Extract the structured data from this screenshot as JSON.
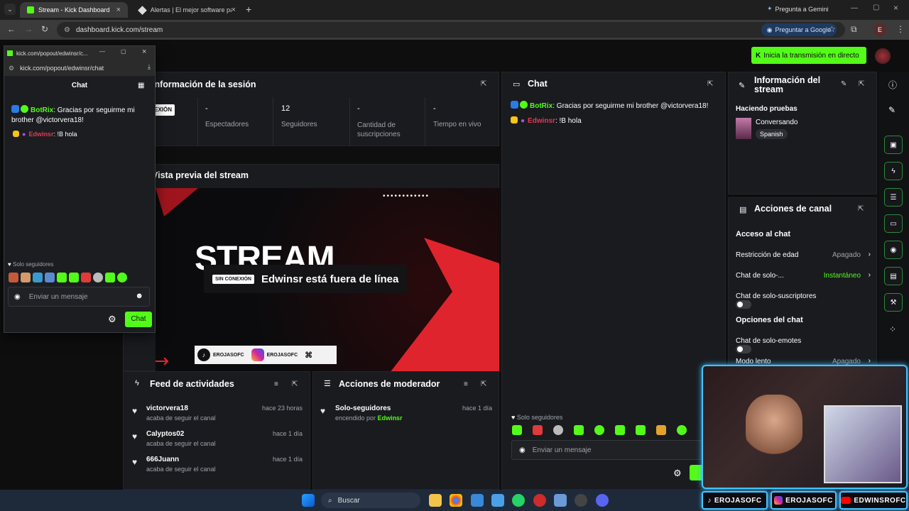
{
  "browser": {
    "tabs": [
      {
        "title": "Stream - Kick Dashboard"
      },
      {
        "title": "Alertas | El mejor software para"
      }
    ],
    "gemini_label": "Pregunta a Gemini",
    "url": "dashboard.kick.com/stream",
    "google_label": "Preguntar a Google",
    "profile_initial": "E"
  },
  "topbar": {
    "go_live_label": "Inicia la transmisión en directo"
  },
  "popup": {
    "title_url": "kick.com/popout/edwinsr/c...",
    "address": "kick.com/popout/edwinsr/chat",
    "header": "Chat",
    "messages": [
      {
        "user": "BotRix",
        "text": ": Gracias por seguirme mi brother @victorvera18!"
      },
      {
        "user": "Edwinsr",
        "text": ": !B hola"
      }
    ],
    "followers_only": "Solo seguidores",
    "input_placeholder": "Enviar un mensaje",
    "send_label": "Chat"
  },
  "session": {
    "title": "Información de la sesión",
    "badge": "SIN CONEXIÓN",
    "stats": [
      {
        "value": "-",
        "label": "Espectadores"
      },
      {
        "value": "12",
        "label": "Seguidores"
      },
      {
        "value": "-",
        "label": "Cantidad de suscripciones"
      },
      {
        "value": "-",
        "label": "Tiempo en vivo"
      }
    ]
  },
  "preview": {
    "title": "Vista previa del stream",
    "offline_badge": "SIN CONEXIÓN",
    "offline_text": "Edwinsr está fuera de línea",
    "big_text": "STREAM",
    "handle1": "EROJASOFC",
    "handle2": "EROJASOFC"
  },
  "chat": {
    "title": "Chat",
    "messages": [
      {
        "user": "BotRix",
        "text": ": Gracias por seguirme mi brother @victorvera18!"
      },
      {
        "user": "Edwinsr",
        "text": ": !B hola"
      }
    ],
    "followers_only": "Solo seguidores",
    "input_placeholder": "Enviar un mensaje",
    "send_label": "C"
  },
  "stream_info": {
    "title": "Información del stream",
    "stream_title": "Haciendo pruebas",
    "category": "Conversando",
    "language": "Spanish"
  },
  "channel_actions": {
    "title": "Acciones de canal",
    "section1": "Acceso al chat",
    "rows": [
      {
        "label": "Restricción de edad",
        "value": "Apagado"
      },
      {
        "label": "Chat de solo-...",
        "value": "Instantáneo"
      },
      {
        "label": "Chat de solo-suscriptores",
        "value": ""
      }
    ],
    "section2": "Opciones del chat",
    "rows2": [
      {
        "label": "Chat de solo-emotes",
        "value": ""
      },
      {
        "label": "Modo lento",
        "value": "Apagado"
      }
    ]
  },
  "feed": {
    "title": "Feed de actividades",
    "items": [
      {
        "user": "victorvera18",
        "action": "acaba de seguir el canal",
        "time": "hace 23 horas"
      },
      {
        "user": "Calyptos02",
        "action": "acaba de seguir el canal",
        "time": "hace 1 día"
      },
      {
        "user": "666Juann",
        "action": "acaba de seguir el canal",
        "time": "hace 1 día"
      }
    ]
  },
  "moderator": {
    "title": "Acciones de moderador",
    "items": [
      {
        "action": "Solo-seguidores",
        "detail": "encendido por",
        "by": "Edwinsr",
        "time": "hace 1 día"
      }
    ]
  },
  "taskbar": {
    "search_placeholder": "Buscar"
  },
  "overlay": {
    "social1": "EROJASOFC",
    "social2": "EROJASOFC",
    "social3": "EDWINSROFC"
  },
  "colors": {
    "kick_green": "#53fc18",
    "botrix_green": "#53fc18",
    "edwinsr_red": "#e03a55"
  }
}
